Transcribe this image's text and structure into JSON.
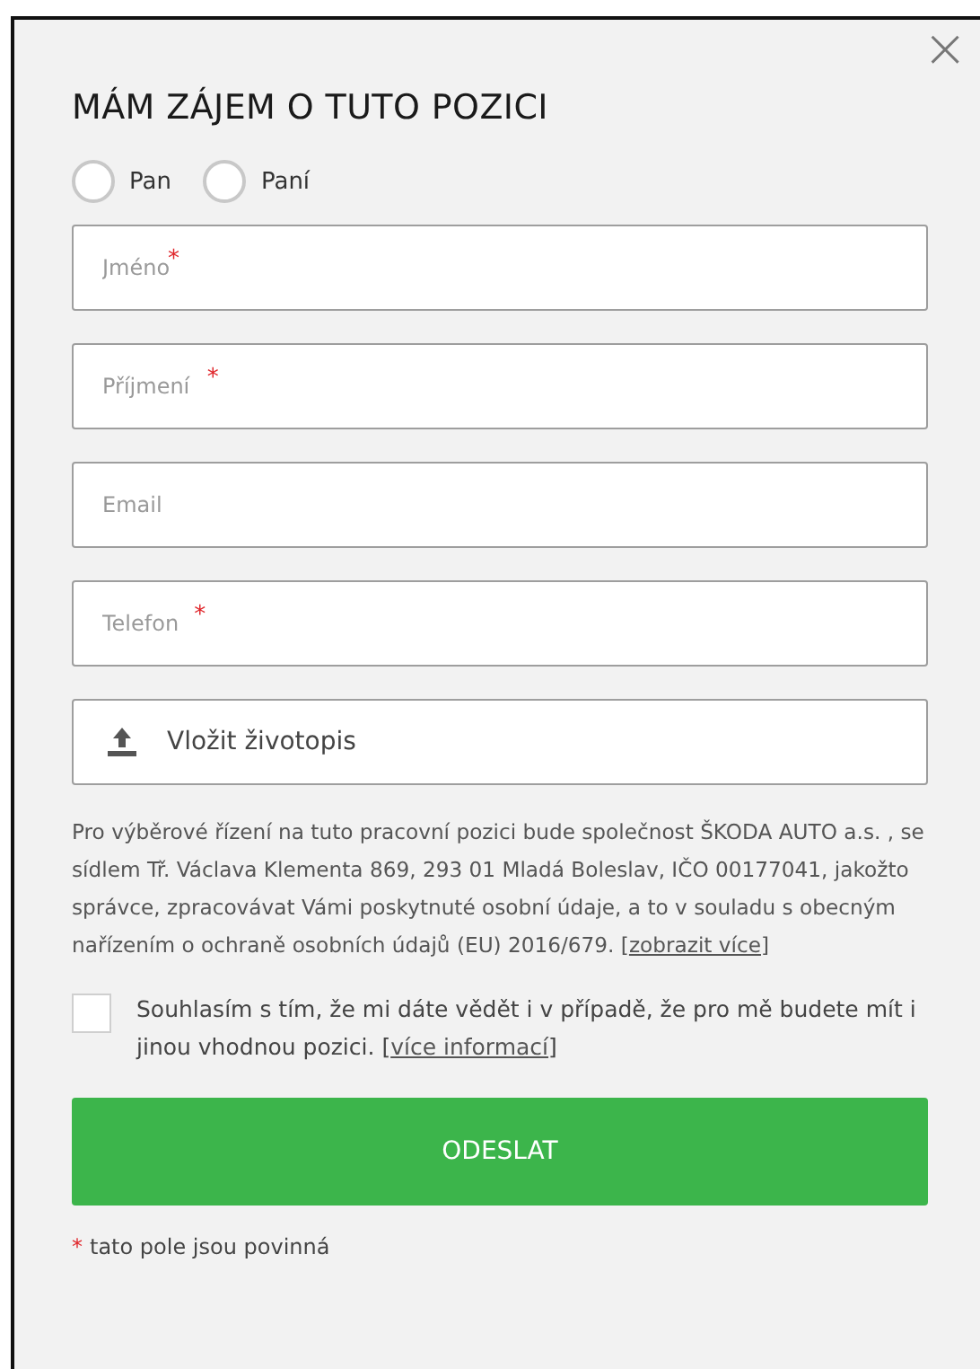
{
  "dialog": {
    "close_icon": "×",
    "title": "MÁM ZÁJEM O TUTO POZICI"
  },
  "salutation": [
    {
      "label": "Pan",
      "selected": false
    },
    {
      "label": "Paní",
      "selected": false
    }
  ],
  "fields": [
    {
      "placeholder": "Jméno",
      "required_mark": "*"
    },
    {
      "placeholder": "Příjmení",
      "required_mark": "*"
    },
    {
      "placeholder": "Email"
    },
    {
      "placeholder": "Telefon",
      "required_mark": "*"
    }
  ],
  "upload": {
    "label": "Vložit životopis"
  },
  "notice": {
    "text": "Pro výběrové řízení na tuto pracovní pozici bude společnost ŠKODA AUTO a.s. , se sídlem Tř. Václava Klementa 869, 293 01 Mladá Boleslav, IČO 00177041, jakožto správce, zpracovávat Vámi poskytnuté osobní údaje, a to v souladu s obecným nařízením o ochraně osobních údajů (EU) 2016/679. [",
    "link": "zobrazit více",
    "after": "]"
  },
  "consent": {
    "checked": false,
    "text": "Souhlasím s tím, že mi dáte vědět i v případě, že pro mě budete mít i jinou vhodnou pozici. [",
    "link": "více informací",
    "after": "]"
  },
  "submit": "ODESLAT",
  "footnote": {
    "mark": "*",
    "text": "tato pole jsou povinná"
  }
}
